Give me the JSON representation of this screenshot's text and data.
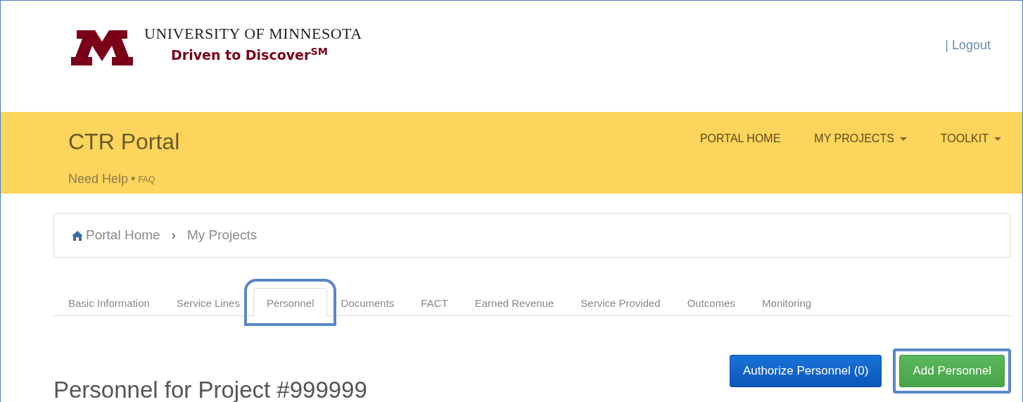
{
  "header": {
    "university": "UNIVERSITY OF MINNESOTA",
    "tagline": "Driven to Discover$^{SM}$",
    "logout": "| Logout"
  },
  "portal": {
    "title": "CTR Portal",
    "help": "Need Help",
    "separator": "•",
    "faq": "FAQ"
  },
  "nav": [
    {
      "label": "PORTAL HOME",
      "dropdown": false
    },
    {
      "label": "MY PROJECTS",
      "dropdown": true
    },
    {
      "label": "TOOLKIT",
      "dropdown": true
    }
  ],
  "breadcrumb": [
    {
      "label": "Portal Home",
      "kind": "home"
    },
    {
      "label": "›",
      "kind": "separator"
    },
    {
      "label": "My Projects",
      "kind": "link"
    }
  ],
  "tabs": [
    {
      "label": "Basic Information",
      "selected": false,
      "highlighted": false
    },
    {
      "label": "Service Lines",
      "selected": false,
      "highlighted": false
    },
    {
      "label": "Personnel",
      "selected": true,
      "highlighted": true
    },
    {
      "label": "Documents",
      "selected": false,
      "highlighted": false
    },
    {
      "label": "FACT",
      "selected": false,
      "highlighted": false
    },
    {
      "label": "Earned Revenue",
      "selected": false,
      "highlighted": false
    },
    {
      "label": "Service Provided",
      "selected": false,
      "highlighted": false
    },
    {
      "label": "Outcomes",
      "selected": false,
      "highlighted": false
    },
    {
      "label": "Monitoring",
      "selected": false,
      "highlighted": false
    }
  ],
  "heading": "Personnel for Project #999999",
  "buttons": [
    {
      "label": "Authorize Personnel (0)",
      "kind": "primary",
      "highlighted": false
    },
    {
      "label": "Add Personnel",
      "kind": "success",
      "highlighted": true
    }
  ]
}
